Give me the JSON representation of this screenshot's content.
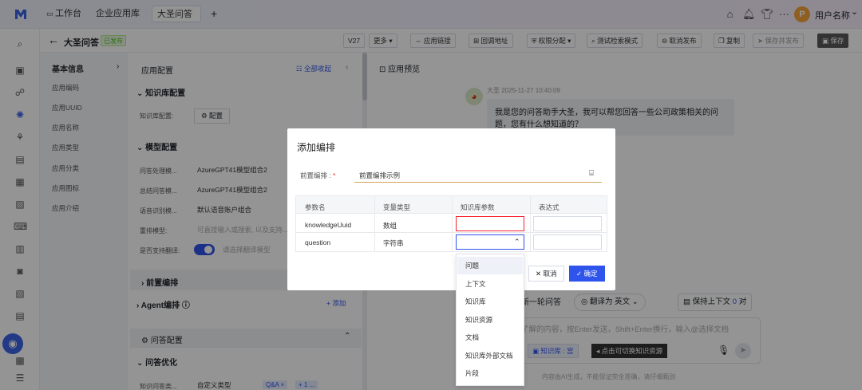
{
  "topbar": {
    "tabs": [
      "工作台",
      "企业应用库",
      "大圣问答"
    ],
    "add": "+",
    "user": "用户名称",
    "avatar": "P",
    "more": "···",
    "caret": "⌄"
  },
  "header": {
    "back": "←",
    "title": "大圣问答",
    "status": "已发布",
    "version": "V27",
    "buttons": [
      "更多 ▾",
      "应用链接",
      "回调地址",
      "权限分配 ▾",
      "测试检索模式",
      "取消发布",
      "复制",
      "保存并发布",
      "保存"
    ]
  },
  "left_nav": {
    "section": "基本信息",
    "items": [
      "应用编码",
      "应用UUID",
      "应用名称",
      "应用类型",
      "应用分类",
      "应用图标",
      "应用介绍"
    ]
  },
  "config": {
    "title": "应用配置",
    "collapse_all": "全部收起",
    "kb_section": "知识库配置",
    "kb_label": "知识库配置:",
    "kb_button": "配置",
    "model_section": "模型配置",
    "rows": [
      {
        "label": "问答处理模...",
        "value": "AzureGPT41模型组合2"
      },
      {
        "label": "总结问答模...",
        "value": "AzureGPT41模型组合2"
      },
      {
        "label": "语音识别模...",
        "value": "默认语音账户组合"
      },
      {
        "label": "重排模型:",
        "value": "可直接输入或搜索, 以及支持..."
      },
      {
        "label": "是否支持翻译:",
        "value": "请选择翻译模型"
      }
    ],
    "pre_section": "前置编排",
    "agent_section": "Agent编排",
    "add": "+ 添加",
    "qa_section": "问答配置",
    "qa_opt": "问答优化",
    "qa_type_label": "知识问答类...",
    "qa_type_value": "自定义类型",
    "tag1": "Q&A ×",
    "tag2": "+ 1 ..."
  },
  "preview": {
    "title": "应用预览",
    "sender": "大圣",
    "time": "2025-11-27 10:40:09",
    "message": "我是您的问答助手大圣，我可以帮您回答一些公司政策相关的问题，您有什么想知道的？",
    "new_round": "新一轮问答",
    "translate": "翻译为",
    "lang": "英文",
    "keep": "保持上下文",
    "keep_count": "0",
    "keep_unit": "对",
    "input_placeholder": "了解的内容，按Enter发送，Shift+Enter换行，输入@选择文档",
    "kb_chip": "知识库 : 宫",
    "tooltip": "点击可切换知识资源",
    "disclaimer": "内容由AI生成，不能保证完全准确，请仔细甄别"
  },
  "modal": {
    "title": "添加编排",
    "field_label": "前置编排 :",
    "field_value": "前置编排示例",
    "columns": [
      "参数名",
      "变量类型",
      "知识库参数",
      "表达式"
    ],
    "rows": [
      {
        "name": "knowledgeUuid",
        "type": "数组"
      },
      {
        "name": "question",
        "type": "字符串"
      }
    ],
    "cancel": "取消",
    "confirm": "确定",
    "dropdown": [
      "问题",
      "上下文",
      "知识库",
      "知识资源",
      "文档",
      "知识库外部文档",
      "片段"
    ]
  },
  "colors": {
    "accent": "#2f54eb",
    "green": "#52c41a",
    "danger": "#f5222d"
  }
}
